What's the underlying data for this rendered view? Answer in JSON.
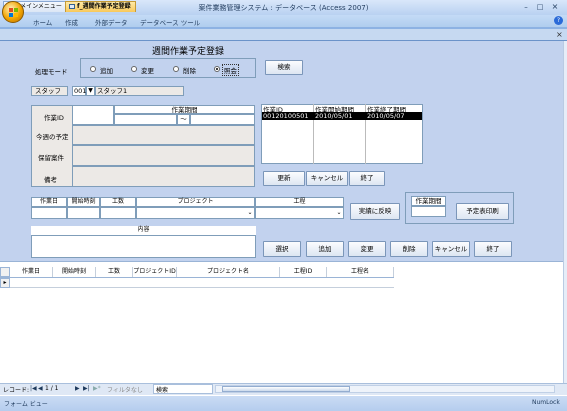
{
  "window": {
    "title": "案件業務管理システム : データベース (Access 2007)"
  },
  "menu": [
    "ホーム",
    "作成",
    "外部データ",
    "データベース ツール"
  ],
  "doc_tabs": [
    "f_メインメニュー",
    "f_週間作業予定登録"
  ],
  "form": {
    "title": "週間作業予定登録",
    "mode_label": "処理モード",
    "modes": [
      "追加",
      "変更",
      "削除",
      "照会"
    ],
    "selected_mode": "照会",
    "search_button": "検索",
    "staff_label": "スタッフ",
    "staff_code": "001",
    "staff_name": "スタッフ1",
    "work_id_label": "作業ID",
    "work_period_label": "作業期間",
    "period_sep": "〜",
    "today_label": "今週の予定",
    "pending_label": "保留案件",
    "note_label": "備考"
  },
  "list": {
    "headers": [
      "作業ID",
      "作業開始期間",
      "作業終了期間"
    ],
    "rows": [
      [
        "00120100501",
        "2010/05/01",
        "2010/05/07"
      ]
    ]
  },
  "list_buttons": [
    "更新",
    "キャンセル",
    "終了"
  ],
  "detail": {
    "headers": [
      "作業日",
      "開始時刻",
      "工数",
      "プロジェクト",
      "工程"
    ],
    "content_label": "内容",
    "reflect_button": "実績に反映"
  },
  "print_box": {
    "label": "作業期間",
    "button": "予定表印刷"
  },
  "action_buttons": [
    "選択",
    "追加",
    "変更",
    "削除",
    "キャンセル",
    "終了"
  ],
  "datasheet": {
    "headers": [
      "作業日",
      "開始時刻",
      "工数",
      "プロジェクトID",
      "プロジェクト名",
      "工程ID",
      "工程名"
    ]
  },
  "navbar": {
    "record_label": "レコード:",
    "record_pos": "1 / 1",
    "filter": "フィルタなし",
    "search": "検索"
  },
  "status": {
    "left": "フォーム ビュー",
    "right": "NumLock"
  }
}
